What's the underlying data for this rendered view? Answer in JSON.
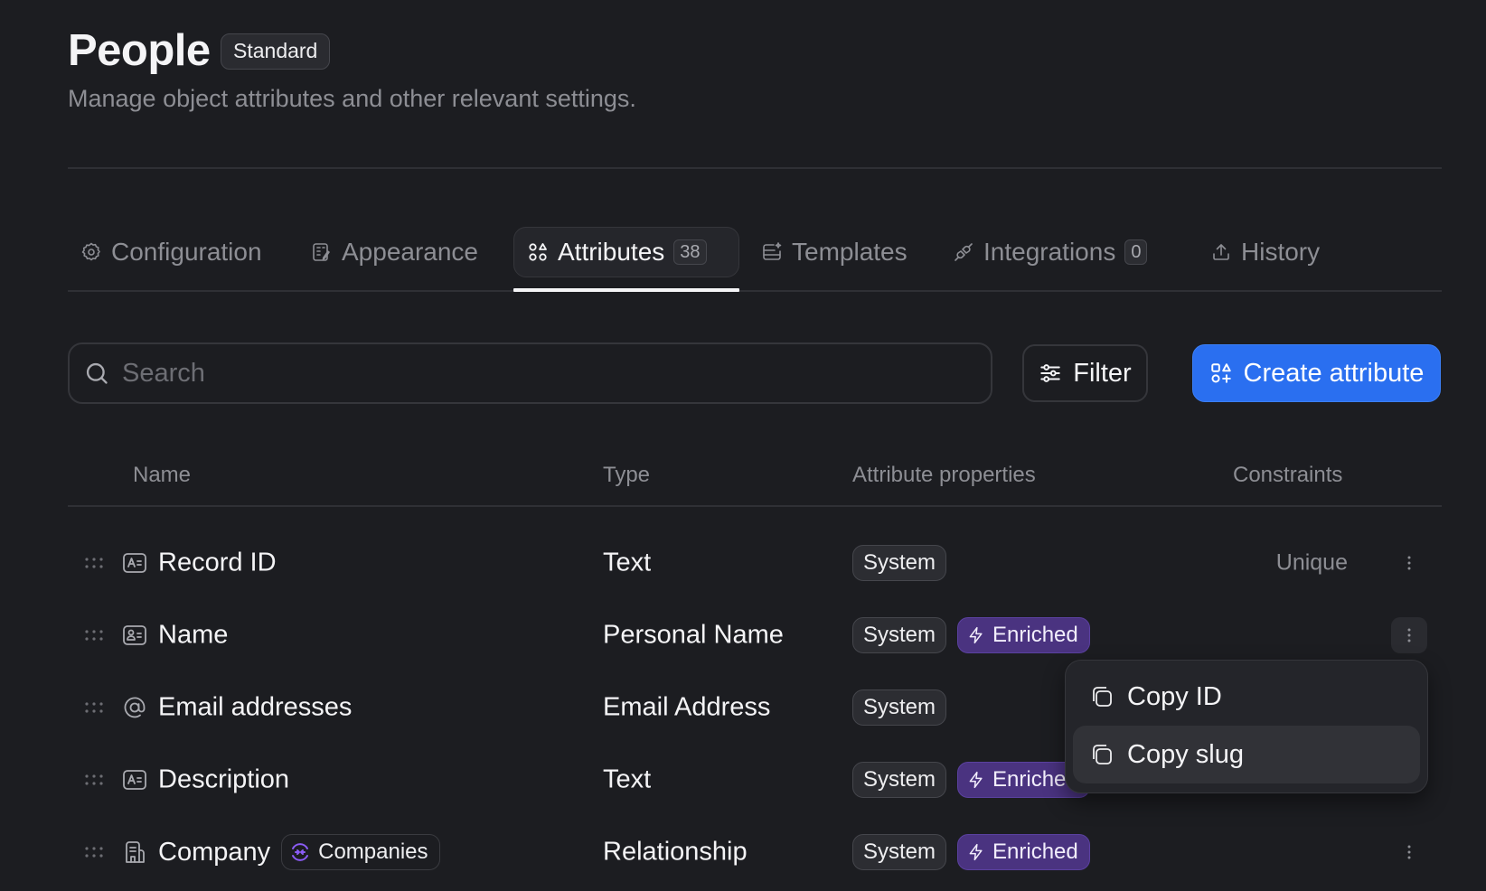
{
  "header": {
    "title": "People",
    "badge": "Standard",
    "subtitle": "Manage object attributes and other relevant settings."
  },
  "tabs": [
    {
      "label": "Configuration",
      "icon": "gear-icon",
      "active": false
    },
    {
      "label": "Appearance",
      "icon": "appearance-icon",
      "active": false
    },
    {
      "label": "Attributes",
      "icon": "shapes-icon",
      "active": true,
      "count": "38"
    },
    {
      "label": "Templates",
      "icon": "templates-icon",
      "active": false
    },
    {
      "label": "Integrations",
      "icon": "plug-icon",
      "active": false,
      "count": "0"
    },
    {
      "label": "History",
      "icon": "upload-icon",
      "active": false
    }
  ],
  "toolbar": {
    "search_placeholder": "Search",
    "search_value": "",
    "filter_label": "Filter",
    "create_label": "Create attribute"
  },
  "table": {
    "columns": [
      "Name",
      "Type",
      "Attribute properties",
      "Constraints"
    ],
    "rows": [
      {
        "name": "Record ID",
        "icon": "text-icon",
        "type": "Text",
        "props": [
          "System"
        ],
        "enriched": false,
        "constraint": "Unique"
      },
      {
        "name": "Name",
        "icon": "person-card-icon",
        "type": "Personal Name",
        "props": [
          "System"
        ],
        "enriched": true,
        "constraint": ""
      },
      {
        "name": "Email addresses",
        "icon": "at-icon",
        "type": "Email Address",
        "props": [
          "System"
        ],
        "enriched": false,
        "constraint": ""
      },
      {
        "name": "Description",
        "icon": "text-icon",
        "type": "Text",
        "props": [
          "System"
        ],
        "enriched": true,
        "constraint": ""
      },
      {
        "name": "Company",
        "icon": "building-icon",
        "type": "Relationship",
        "props": [
          "System"
        ],
        "enriched": true,
        "constraint": "",
        "relation": "Companies"
      }
    ],
    "system_label": "System",
    "enriched_label": "Enriched"
  },
  "context_menu": {
    "items": [
      {
        "label": "Copy ID",
        "icon": "copy-icon"
      },
      {
        "label": "Copy slug",
        "icon": "copy-icon",
        "hovered": true
      }
    ]
  },
  "colors": {
    "background": "#1c1d21",
    "accent": "#2a6ff0",
    "enriched": "#4a3380",
    "relation_icon": "#8b5cf6"
  }
}
